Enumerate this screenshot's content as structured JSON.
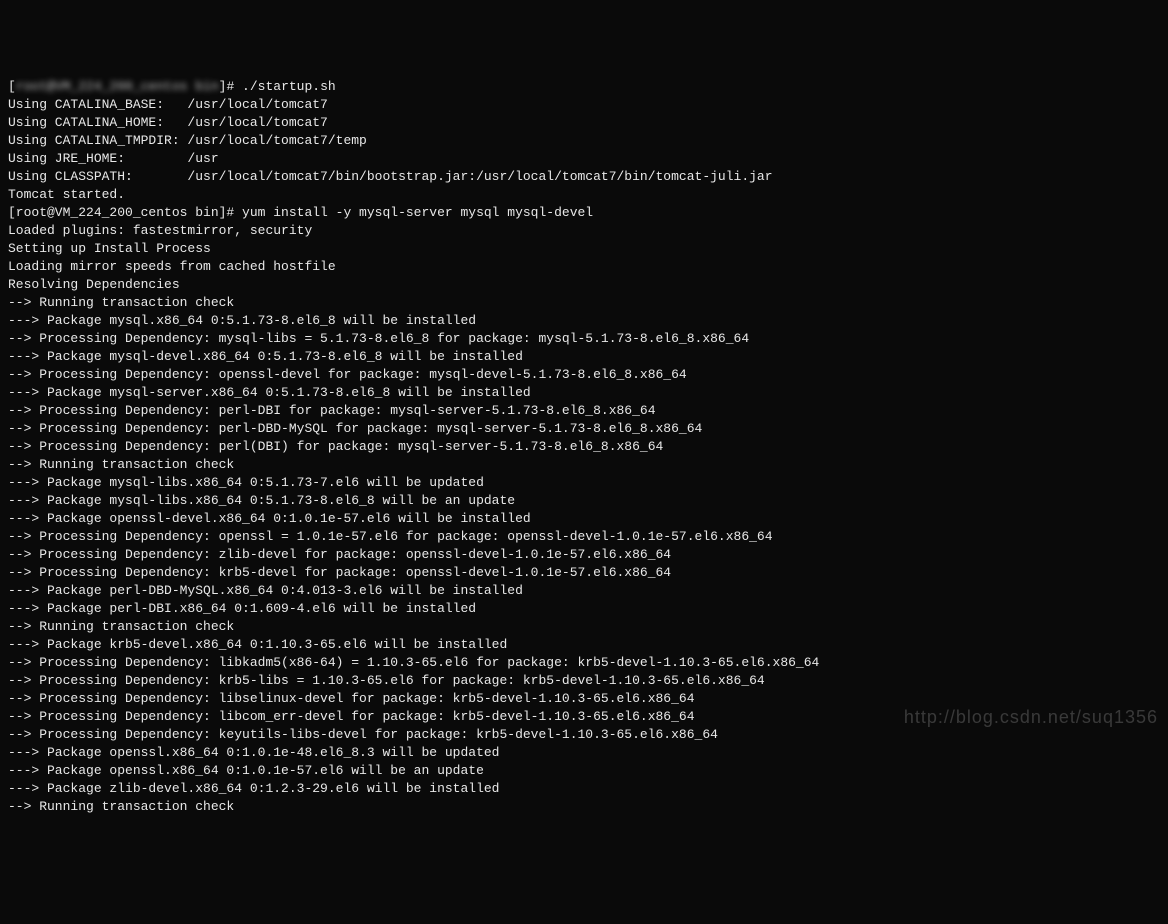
{
  "lines": [
    {
      "pre": "[",
      "blur": "root@VM_224_200_centos bin",
      "post": "]# ./startup.sh"
    },
    "Using CATALINA_BASE:   /usr/local/tomcat7",
    "Using CATALINA_HOME:   /usr/local/tomcat7",
    "Using CATALINA_TMPDIR: /usr/local/tomcat7/temp",
    "Using JRE_HOME:        /usr",
    "Using CLASSPATH:       /usr/local/tomcat7/bin/bootstrap.jar:/usr/local/tomcat7/bin/tomcat-juli.jar",
    "Tomcat started.",
    "[root@VM_224_200_centos bin]# yum install -y mysql-server mysql mysql-devel",
    "Loaded plugins: fastestmirror, security",
    "Setting up Install Process",
    "Loading mirror speeds from cached hostfile",
    "Resolving Dependencies",
    "--> Running transaction check",
    "---> Package mysql.x86_64 0:5.1.73-8.el6_8 will be installed",
    "--> Processing Dependency: mysql-libs = 5.1.73-8.el6_8 for package: mysql-5.1.73-8.el6_8.x86_64",
    "---> Package mysql-devel.x86_64 0:5.1.73-8.el6_8 will be installed",
    "--> Processing Dependency: openssl-devel for package: mysql-devel-5.1.73-8.el6_8.x86_64",
    "---> Package mysql-server.x86_64 0:5.1.73-8.el6_8 will be installed",
    "--> Processing Dependency: perl-DBI for package: mysql-server-5.1.73-8.el6_8.x86_64",
    "--> Processing Dependency: perl-DBD-MySQL for package: mysql-server-5.1.73-8.el6_8.x86_64",
    "--> Processing Dependency: perl(DBI) for package: mysql-server-5.1.73-8.el6_8.x86_64",
    "--> Running transaction check",
    "---> Package mysql-libs.x86_64 0:5.1.73-7.el6 will be updated",
    "---> Package mysql-libs.x86_64 0:5.1.73-8.el6_8 will be an update",
    "---> Package openssl-devel.x86_64 0:1.0.1e-57.el6 will be installed",
    "--> Processing Dependency: openssl = 1.0.1e-57.el6 for package: openssl-devel-1.0.1e-57.el6.x86_64",
    "--> Processing Dependency: zlib-devel for package: openssl-devel-1.0.1e-57.el6.x86_64",
    "--> Processing Dependency: krb5-devel for package: openssl-devel-1.0.1e-57.el6.x86_64",
    "---> Package perl-DBD-MySQL.x86_64 0:4.013-3.el6 will be installed",
    "---> Package perl-DBI.x86_64 0:1.609-4.el6 will be installed",
    "--> Running transaction check",
    "---> Package krb5-devel.x86_64 0:1.10.3-65.el6 will be installed",
    "--> Processing Dependency: libkadm5(x86-64) = 1.10.3-65.el6 for package: krb5-devel-1.10.3-65.el6.x86_64",
    "--> Processing Dependency: krb5-libs = 1.10.3-65.el6 for package: krb5-devel-1.10.3-65.el6.x86_64",
    "--> Processing Dependency: libselinux-devel for package: krb5-devel-1.10.3-65.el6.x86_64",
    "--> Processing Dependency: libcom_err-devel for package: krb5-devel-1.10.3-65.el6.x86_64",
    "--> Processing Dependency: keyutils-libs-devel for package: krb5-devel-1.10.3-65.el6.x86_64",
    "---> Package openssl.x86_64 0:1.0.1e-48.el6_8.3 will be updated",
    "---> Package openssl.x86_64 0:1.0.1e-57.el6 will be an update",
    "---> Package zlib-devel.x86_64 0:1.2.3-29.el6 will be installed",
    "--> Running transaction check"
  ],
  "watermark": "http://blog.csdn.net/suq1356"
}
